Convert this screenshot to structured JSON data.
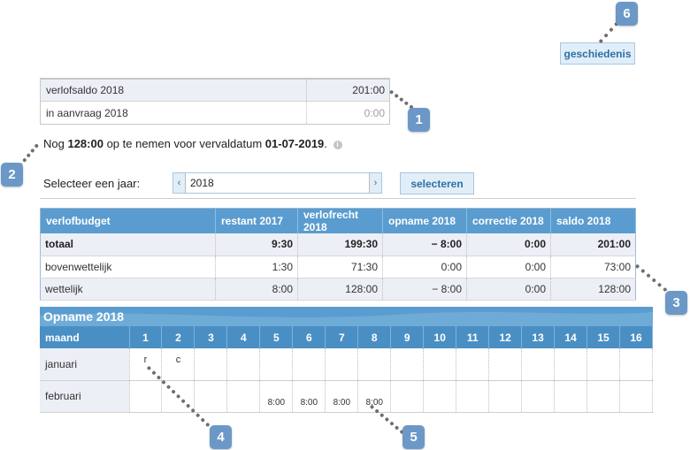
{
  "header": {
    "history_button": "geschiedenis"
  },
  "saldo": [
    {
      "label": "verlofsaldo 2018",
      "value": "201:00"
    },
    {
      "label": "in aanvraag 2018",
      "value": "0:00"
    }
  ],
  "sentence": {
    "part1": "Nog ",
    "hours": "128:00",
    "part2": " op te nemen voor vervaldatum ",
    "date": "01-07-2019",
    "part3": ".",
    "info_icon": "i"
  },
  "year_select": {
    "label": "Selecteer een jaar:",
    "prev": "‹",
    "next": "›",
    "value": "2018",
    "button": "selecteren"
  },
  "budget": {
    "headers": [
      "verlofbudget",
      "restant 2017",
      "verlofrecht 2018",
      "opname 2018",
      "correctie 2018",
      "saldo 2018"
    ],
    "rows": [
      [
        "totaal",
        "9:30",
        "199:30",
        "− 8:00",
        "0:00",
        "201:00"
      ],
      [
        "bovenwettelijk",
        "1:30",
        "71:30",
        "0:00",
        "0:00",
        "73:00"
      ],
      [
        "wettelijk",
        "8:00",
        "128:00",
        "− 8:00",
        "0:00",
        "128:00"
      ]
    ]
  },
  "opname": {
    "title": "Opname 2018",
    "month_header": "maand",
    "days": [
      "1",
      "2",
      "3",
      "4",
      "5",
      "6",
      "7",
      "8",
      "9",
      "10",
      "11",
      "12",
      "13",
      "14",
      "15",
      "16"
    ],
    "months": [
      {
        "name": "januari",
        "cells": [
          "r",
          "c",
          "",
          "",
          "",
          "",
          "",
          "",
          "",
          "",
          "",
          "",
          "",
          "",
          "",
          ""
        ]
      },
      {
        "name": "februari",
        "cells": [
          "",
          "",
          "",
          "",
          "8:00",
          "8:00",
          "8:00",
          "8:00",
          "",
          "",
          "",
          "",
          "",
          "",
          "",
          ""
        ]
      }
    ]
  },
  "callouts": [
    "1",
    "2",
    "3",
    "4",
    "5",
    "6"
  ]
}
